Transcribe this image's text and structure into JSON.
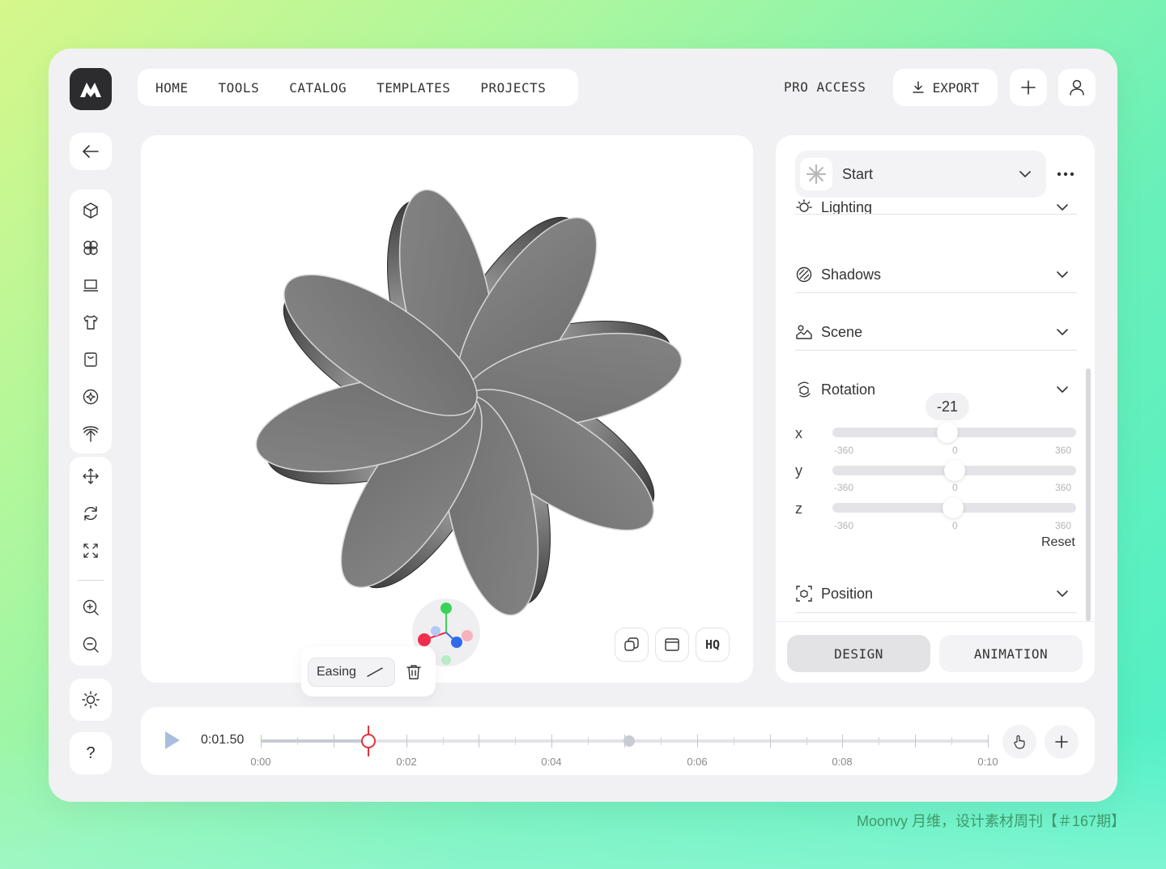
{
  "topnav": {
    "items": [
      "HOME",
      "TOOLS",
      "CATALOG",
      "TEMPLATES",
      "PROJECTS"
    ],
    "pro_access": "PRO ACCESS",
    "export": "EXPORT"
  },
  "canvas": {
    "hq_label": "HQ",
    "easing_label": "Easing"
  },
  "panel": {
    "preset": "Start",
    "sections": {
      "lighting": "Lighting",
      "shadows": "Shadows",
      "scene": "Scene",
      "rotation": "Rotation",
      "position": "Position"
    },
    "rotation": {
      "bubble_value": "-21",
      "axes": [
        "x",
        "y",
        "z"
      ],
      "x_value": -21,
      "y_value": 0,
      "z_value": -3,
      "min_label": "-360",
      "mid_label": "0",
      "max_label": "360",
      "reset": "Reset"
    },
    "tabs": {
      "design": "DESIGN",
      "animation": "ANIMATION"
    }
  },
  "timeline": {
    "current_time": "0:01.50",
    "labels": [
      "0:00",
      "0:02",
      "0:04",
      "0:06",
      "0:08",
      "0:10"
    ]
  },
  "help_label": "?",
  "watermark": "Moonvy 月维，设计素材周刊【＃167期】",
  "colors": {
    "accent_red": "#e0343e",
    "gizmo_green": "#3ad35a",
    "gizmo_blue": "#2f6bea",
    "gizmo_red": "#ee2f4d"
  }
}
